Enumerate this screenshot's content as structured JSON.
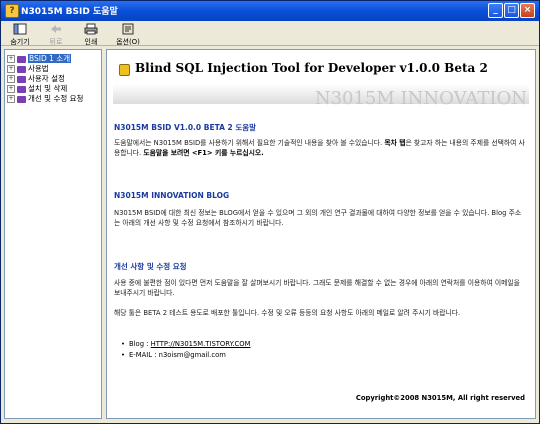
{
  "window": {
    "title": "N3015M BSID 도움말"
  },
  "toolbar": {
    "hide": "숨기기",
    "back": "뒤로",
    "print": "인쇄",
    "options": "옵션(O)"
  },
  "tree": {
    "items": [
      {
        "label": "BSID 1 소개",
        "selected": true
      },
      {
        "label": "사용법"
      },
      {
        "label": "사용자 설정"
      },
      {
        "label": "설치 및 삭제"
      },
      {
        "label": "개선 및 수정 요청"
      }
    ]
  },
  "content": {
    "heading": "Blind SQL Injection Tool for Developer v1.0.0 Beta 2",
    "watermark": "N3015M INNOVATION",
    "section1": {
      "title": "N3015M BSID V1.0.0 BETA 2 도움말",
      "body_part1": "도움말에서는 N3015M BSID를 사용하기 위해서 필요한 기술적인 내용을 찾아 볼 수있습니다. ",
      "body_bold1": "목차 탭",
      "body_part2": "은 찾고자 하는 내용의 주제를 선택하여 사용합니다. ",
      "body_bold2": "도움말을 보려면 <F1> 키를 누르십시오."
    },
    "section2": {
      "title": "N3015M INNOVATION BLOG",
      "body": "N3015M BSID에 대한 최신 정보는 BLOG에서 얻을 수 있으며 그 외의 개인 연구 결과물에 대하여 다양한 정보를 얻을 수 있습니다. Blog 주소는 아래의 개선 사항 및 수정 요청에서 참조하시기 바랍니다."
    },
    "section3": {
      "title": "개선 사항 및 수정 요청",
      "body1": "사용 중에 불편한 점이 있다면 먼저 도움말을 잘 살펴보시기 바랍니다. 그래도 문제를 해결할 수 없는 경우에 아래의 연락처를 이용하여 이메일을 보내주시기 바랍니다.",
      "body2": "해당 툴은 BETA 2 테스트 용도로 배포한 툴입니다. 수정 및 오류 등등의 요청 사항도 아래의 메일로 알려 주시기 바랍니다.",
      "blog_label": "Blog : ",
      "blog_link": "HTTP://N3015M.TISTORY.COM",
      "email_label": "E-MAIL : ",
      "email_value": "n3oism@gmail.com"
    },
    "copyright": "Copyright©2008 N3015M, All right reserved"
  }
}
